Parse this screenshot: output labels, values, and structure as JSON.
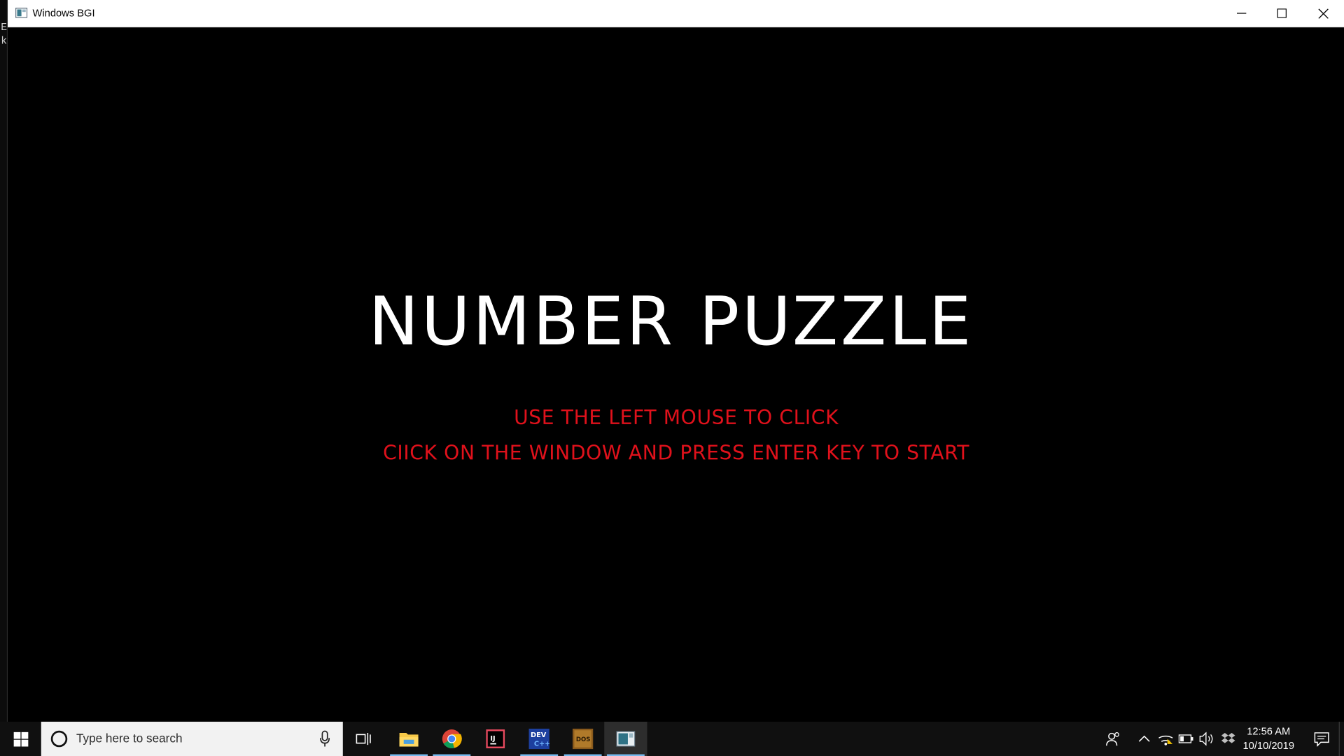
{
  "window": {
    "title": "Windows BGI"
  },
  "console": {
    "line1": "E",
    "line2": "k"
  },
  "game": {
    "title": "NUMBER PUZZLE",
    "instruction1": "USE THE LEFT MOUSE TO CLICK",
    "instruction2": "CIICK ON THE WINDOW AND PRESS ENTER KEY TO START"
  },
  "colors": {
    "title_text": "#ffffff",
    "instruction_text": "#e0111b",
    "background": "#000000",
    "taskbar": "#101010",
    "active_underline": "#76b9ed"
  },
  "taskbar": {
    "search_placeholder": "Type here to search",
    "pinned": [
      {
        "name": "file-explorer",
        "icon": "folder-icon"
      },
      {
        "name": "chrome",
        "icon": "chrome-icon"
      },
      {
        "name": "intellij",
        "icon": "intellij-icon"
      },
      {
        "name": "dev-cpp",
        "icon": "devcpp-icon"
      },
      {
        "name": "dosbox",
        "icon": "dosbox-icon"
      },
      {
        "name": "windows-bgi",
        "icon": "bgi-window-icon"
      }
    ],
    "clock": {
      "time": "12:56 AM",
      "date": "10/10/2019"
    }
  }
}
